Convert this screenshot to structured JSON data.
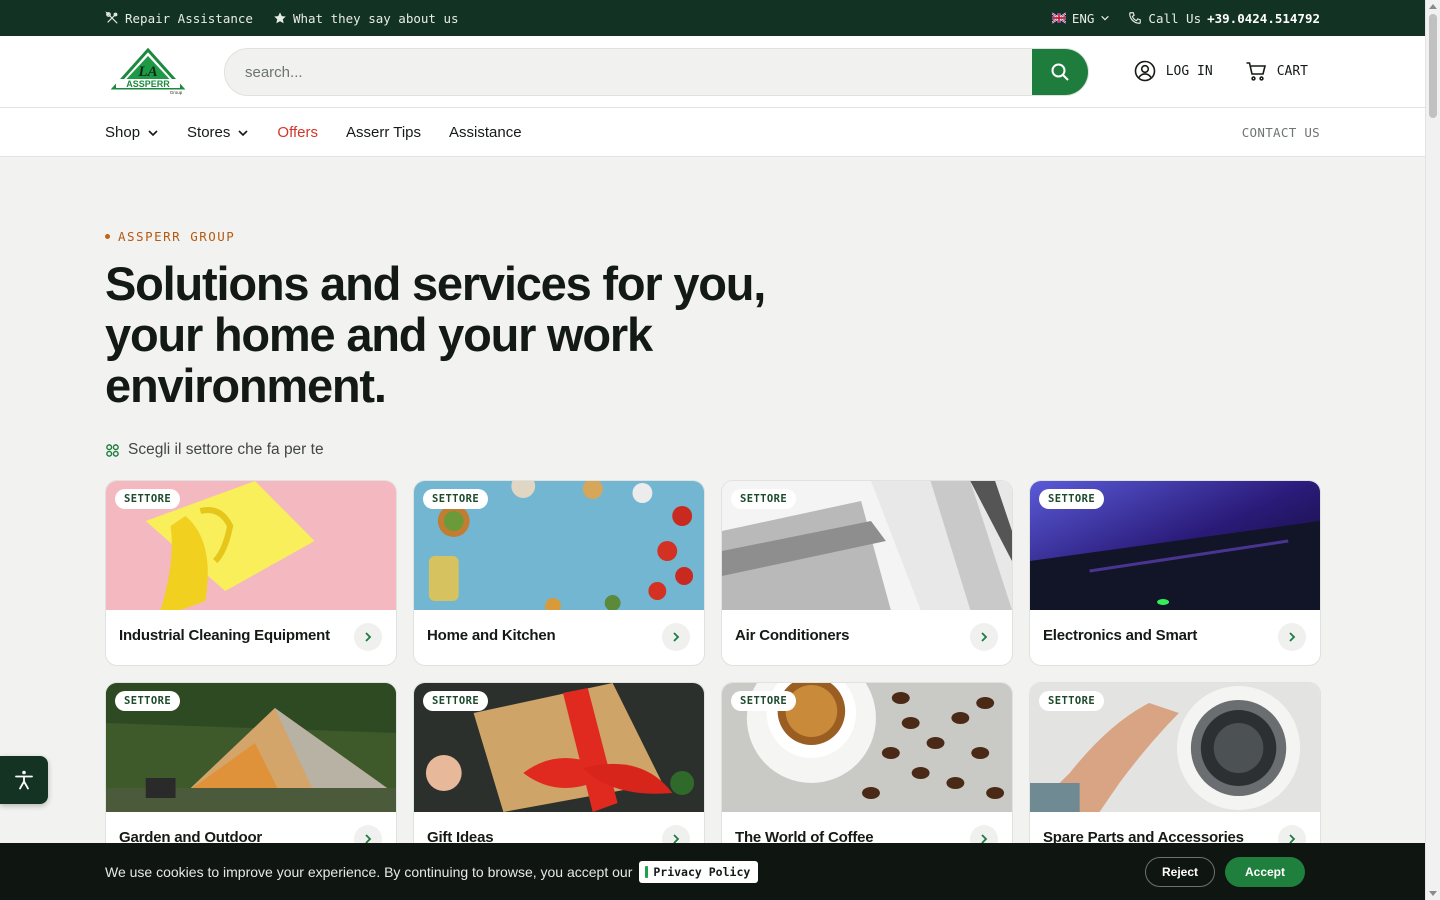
{
  "topbar": {
    "repair": "Repair Assistance",
    "reviews": "What they say about us",
    "language": "ENG",
    "call_label": "Call Us",
    "phone": "+39.0424.514792"
  },
  "header": {
    "logo_text": "ASSPERR",
    "logo_sub": "Group",
    "search_placeholder": "search...",
    "login": "LOG IN",
    "cart": "CART"
  },
  "nav": {
    "items": [
      {
        "label": "Shop",
        "dropdown": true
      },
      {
        "label": "Stores",
        "dropdown": true
      },
      {
        "label": "Offers",
        "dropdown": false
      },
      {
        "label": "Asserr Tips",
        "dropdown": false
      },
      {
        "label": "Assistance",
        "dropdown": false
      }
    ],
    "contact": "CONTACT US"
  },
  "hero": {
    "eyebrow": "ASSPERR GROUP",
    "title_line1": "Solutions and services for you,",
    "title_line2": "your home and your work",
    "title_line3": "environment.",
    "sector_hint": "Scegli il settore che fa per te"
  },
  "cards": [
    {
      "badge": "SETTORE",
      "label": "Industrial Cleaning Equipment",
      "image": "yellow-glove-on-pink"
    },
    {
      "badge": "SETTORE",
      "label": "Home and Kitchen",
      "image": "food-ingredients-on-blue"
    },
    {
      "badge": "SETTORE",
      "label": "Air Conditioners",
      "image": "air-conditioner-vents"
    },
    {
      "badge": "SETTORE",
      "label": "Electronics and Smart",
      "image": "gaming-keyboard-lights"
    },
    {
      "badge": "SETTORE",
      "label": "Garden and Outdoor",
      "image": "camping-tent"
    },
    {
      "badge": "SETTORE",
      "label": "Gift Ideas",
      "image": "gift-box-red-ribbon"
    },
    {
      "badge": "SETTORE",
      "label": "The World of Coffee",
      "image": "coffee-cup-beans"
    },
    {
      "badge": "SETTORE",
      "label": "Spare Parts and Accessories",
      "image": "washing-machine-repair"
    }
  ],
  "cookie": {
    "text": "We use cookies to improve your experience. By continuing to browse, you accept our",
    "privacy": "Privacy Policy",
    "reject": "Reject",
    "accept": "Accept"
  },
  "colors": {
    "topbar_bg": "#123224",
    "brand_green": "#1e7d3c",
    "offers_red": "#d3352b",
    "eyebrow_orange": "#b45a13",
    "cookie_bg": "#0f1511"
  }
}
